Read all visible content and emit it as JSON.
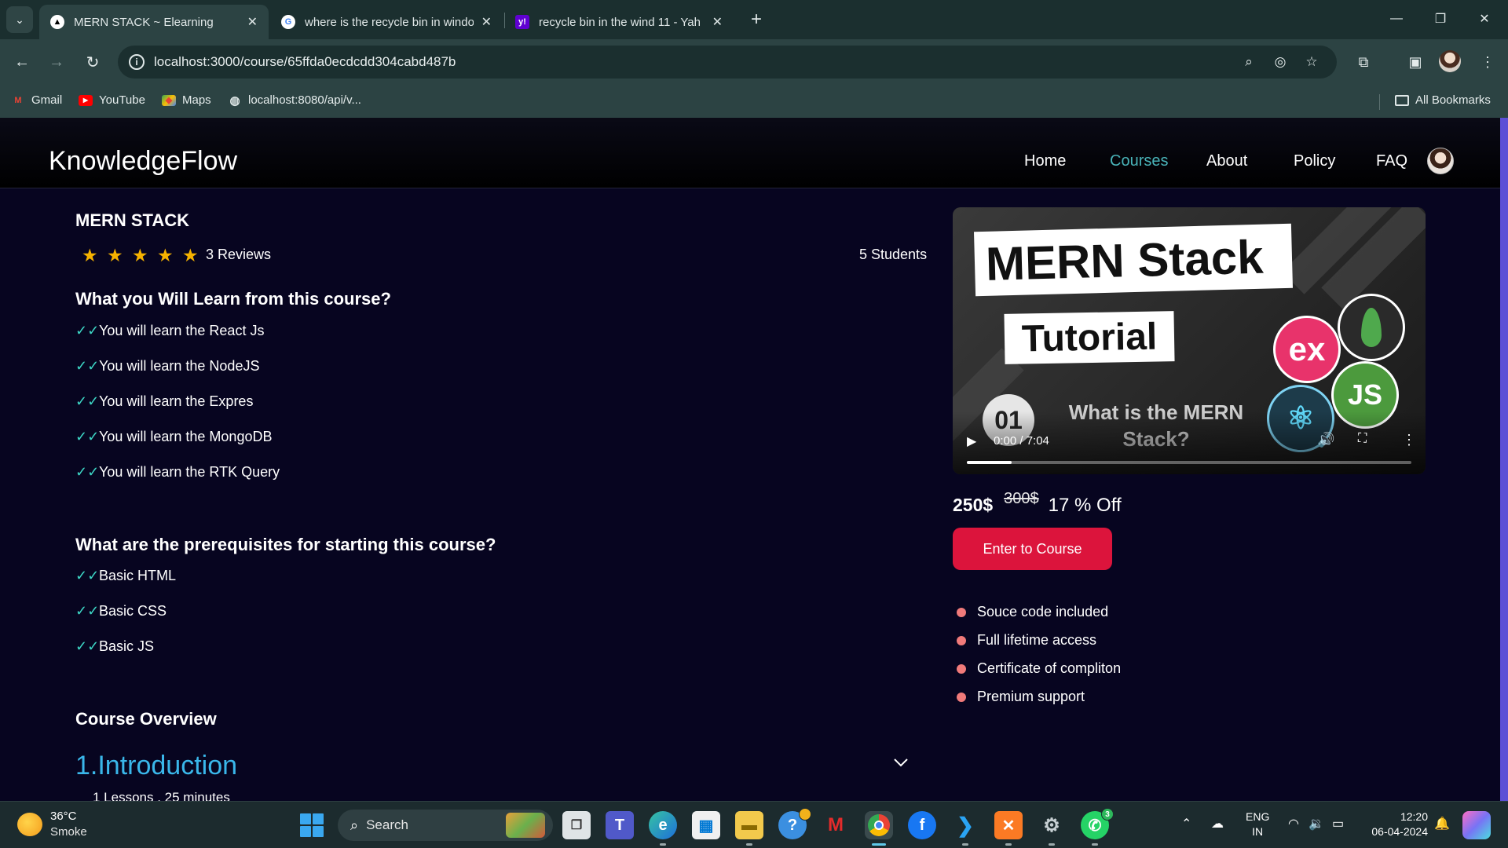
{
  "browser": {
    "tabs": [
      {
        "title": "MERN STACK ~ Elearning",
        "active": true,
        "favicon": "triangle-logo-icon"
      },
      {
        "title": "where is the recycle bin in windo",
        "active": false,
        "favicon": "google-icon"
      },
      {
        "title": "recycle bin in the wind 11 - Yah",
        "active": false,
        "favicon": "yahoo-icon"
      }
    ],
    "url": "localhost:3000/course/65ffda0ecdcdd304cabd487b",
    "bookmarks": [
      {
        "label": "Gmail",
        "icon": "gmail-icon"
      },
      {
        "label": "YouTube",
        "icon": "youtube-icon"
      },
      {
        "label": "Maps",
        "icon": "maps-icon"
      },
      {
        "label": "localhost:8080/api/v...",
        "icon": "globe-icon"
      }
    ],
    "all_bookmarks": "All Bookmarks"
  },
  "site": {
    "brand": "KnowledgeFlow",
    "nav": [
      {
        "label": "Home",
        "active": false
      },
      {
        "label": "Courses",
        "active": true
      },
      {
        "label": "About",
        "active": false
      },
      {
        "label": "Policy",
        "active": false
      },
      {
        "label": "FAQ",
        "active": false
      }
    ],
    "accent_color": "#49b3b8"
  },
  "course": {
    "title": "MERN STACK",
    "rating": 5,
    "reviews": "3 Reviews",
    "students": "5 Students",
    "learn_heading": "What you Will Learn from this course?",
    "learn_items": [
      "You will learn the React Js",
      "You will learn the NodeJS",
      "You will learn the Expres",
      "You will learn the MongoDB",
      "You will learn the RTK Query"
    ],
    "prereq_heading": "What are the prerequisites for starting this course?",
    "prereq_items": [
      "Basic HTML",
      "Basic CSS",
      "Basic JS"
    ],
    "overview_heading": "Course Overview",
    "sections": [
      {
        "title": "1.Introduction",
        "meta": "1 Lessons . 25 minutes"
      }
    ],
    "video": {
      "thumb_line1": "MERN Stack",
      "thumb_line2": "Tutorial",
      "thumb_number": "01",
      "thumb_question": "What is the MERN Stack?",
      "logo_express": "ex",
      "logo_node": "JS",
      "time": "0:00 / 7:04",
      "progress": 0.1
    },
    "price_now": "250$",
    "price_old": "300$",
    "discount": "17 % Off",
    "enter_button": "Enter to Course",
    "features": [
      "Souce code included",
      "Full lifetime access",
      "Certificate of compliton",
      "Premium support"
    ],
    "button_color": "#dc143c"
  },
  "taskbar": {
    "weather_temp": "36°C",
    "weather_desc": "Smoke",
    "search_label": "Search",
    "lang_line1": "ENG",
    "lang_line2": "IN",
    "time": "12:20",
    "date": "06-04-2024",
    "teams_badge": "",
    "whatsapp_badge": "3"
  }
}
